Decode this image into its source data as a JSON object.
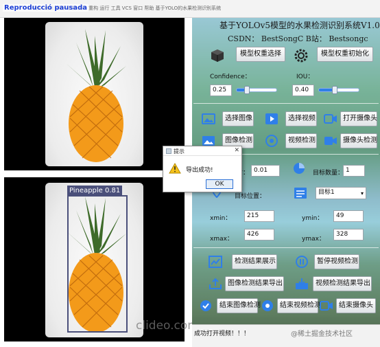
{
  "window": {
    "title": "文件 编辑 视图 导航 代码 重构 运行 工具 VCS 窗口 帮助  基于YOLO的水果检测识别系统",
    "paused_label": "Reproducció pausada"
  },
  "views": {
    "watermark": "clideo.com",
    "detection_label": "Pineapple  0.81"
  },
  "header": {
    "title": "基于YOLOv5模型的水果检测识别系统V1.0",
    "author": "CSDN： BestSongC   B站： Bestsongc"
  },
  "model": {
    "select_label": "模型权重选择",
    "init_label": "模型权重初始化",
    "confidence_label": "Confidence：",
    "confidence_value": "0.25",
    "confidence_fill": 0.25,
    "iou_label": "IOU：",
    "iou_value": "0.40",
    "iou_fill": 0.4
  },
  "actions": {
    "select_image": "选择图像",
    "select_video": "选择视频",
    "open_camera": "打开摄像头",
    "image_detect": "图像检测",
    "video_detect": "视频检测",
    "camera_detect": "摄像头检测"
  },
  "stats": {
    "time_label": "用时：",
    "time_value": "0.01",
    "count_label": "目标数量：",
    "count_value": "1",
    "position_label": "目标位置：",
    "target_select": "目标1",
    "xmin_label": "xmin：",
    "xmin_value": "215",
    "ymin_label": "ymin：",
    "ymin_value": "49",
    "xmax_label": "xmax：",
    "xmax_value": "426",
    "ymax_label": "ymax：",
    "ymax_value": "328"
  },
  "controls": {
    "show_results": "检测结果展示",
    "pause_video": "暂停视频检测",
    "export_image": "图像检测结果导出",
    "export_video": "视频检测结果导出",
    "end_image": "结束图像检测",
    "end_video": "结束视频检测",
    "end_camera": "结束摄像头"
  },
  "dialog": {
    "title": "提示",
    "message": "导出成功!",
    "ok": "OK",
    "close": "✕"
  },
  "status": {
    "text": "成功打开视频！！！",
    "corner_watermark": "@稀土掘金技术社区"
  },
  "colors": {
    "accent": "#2f7fe8",
    "box": "#4a4f7a",
    "pineapple": "#f39a1a",
    "leaves": "#3e6b2a"
  }
}
